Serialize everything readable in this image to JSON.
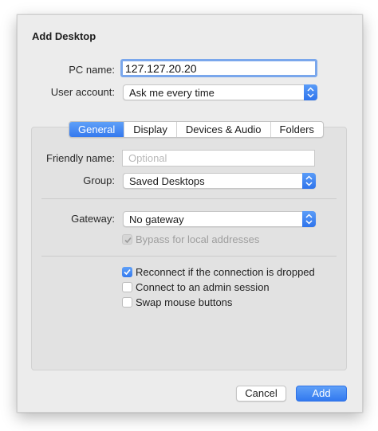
{
  "dialog": {
    "title": "Add Desktop",
    "pc_name_label": "PC name:",
    "pc_name_value": "127.127.20.20",
    "user_account_label": "User account:",
    "user_account_value": "Ask me every time"
  },
  "tabs": [
    {
      "label": "General",
      "active": true
    },
    {
      "label": "Display",
      "active": false
    },
    {
      "label": "Devices & Audio",
      "active": false
    },
    {
      "label": "Folders",
      "active": false
    }
  ],
  "general": {
    "friendly_name_label": "Friendly name:",
    "friendly_name_placeholder": "Optional",
    "group_label": "Group:",
    "group_value": "Saved Desktops",
    "gateway_label": "Gateway:",
    "gateway_value": "No gateway",
    "bypass_label": "Bypass for local addresses",
    "bypass_checked": true,
    "reconnect_label": "Reconnect if the connection is dropped",
    "reconnect_checked": true,
    "admin_label": "Connect to an admin session",
    "admin_checked": false,
    "swap_label": "Swap mouse buttons",
    "swap_checked": false
  },
  "buttons": {
    "cancel": "Cancel",
    "add": "Add"
  },
  "colors": {
    "accent": "#3479ee",
    "annotation_arrow": "#e8202a"
  }
}
